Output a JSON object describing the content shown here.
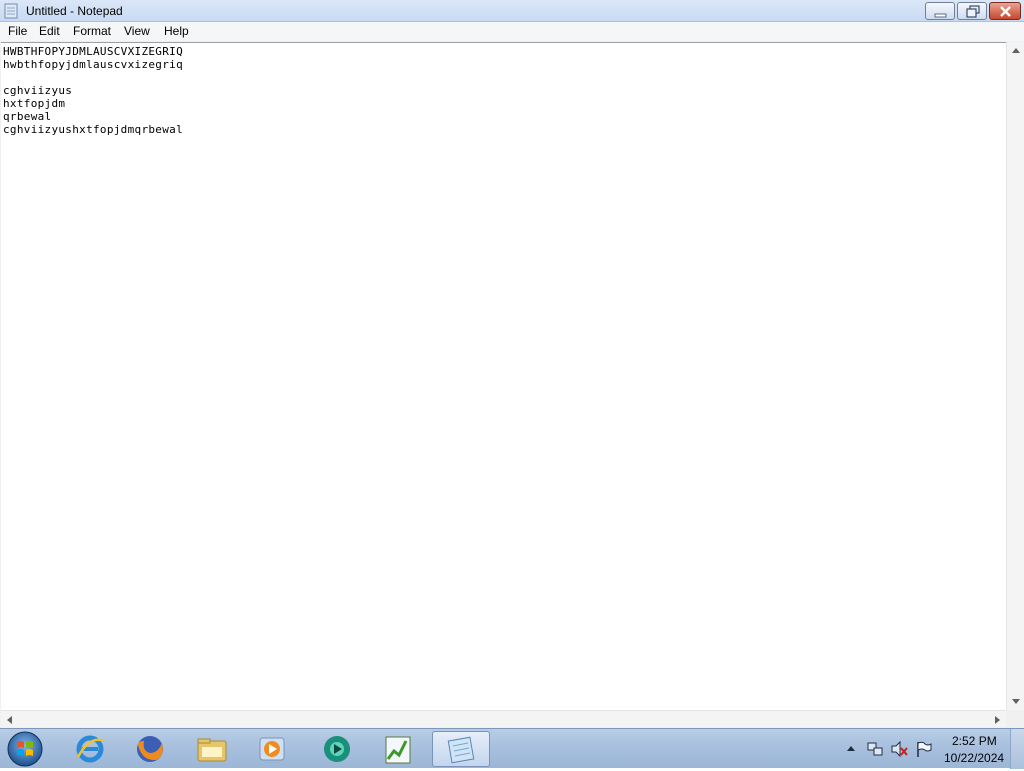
{
  "window": {
    "title": "Untitled - Notepad"
  },
  "menu": {
    "items": [
      "File",
      "Edit",
      "Format",
      "View",
      "Help"
    ]
  },
  "editor": {
    "lines": [
      "HWBTHFOPYJDMLAUSCVXIZEGRIQ",
      "hwbthfopyjdmlauscvxizegriq",
      "",
      "cghviizyus",
      "hxtfopjdm",
      "qrbewal",
      "cghviizyushxtfopjdmqrbewal"
    ]
  },
  "taskbar": {
    "pinned": [
      "start-orb",
      "internet-explorer-icon",
      "firefox-icon",
      "file-explorer-icon",
      "media-player-icon",
      "browser-app-icon",
      "chart-app-icon",
      "notepad-icon"
    ],
    "clock_time": "2:52 PM",
    "clock_date": "10/22/2024"
  },
  "colors": {
    "titlebar": "#c8daf2",
    "taskbar": "#a8c0de",
    "close_button": "#c7472c"
  }
}
